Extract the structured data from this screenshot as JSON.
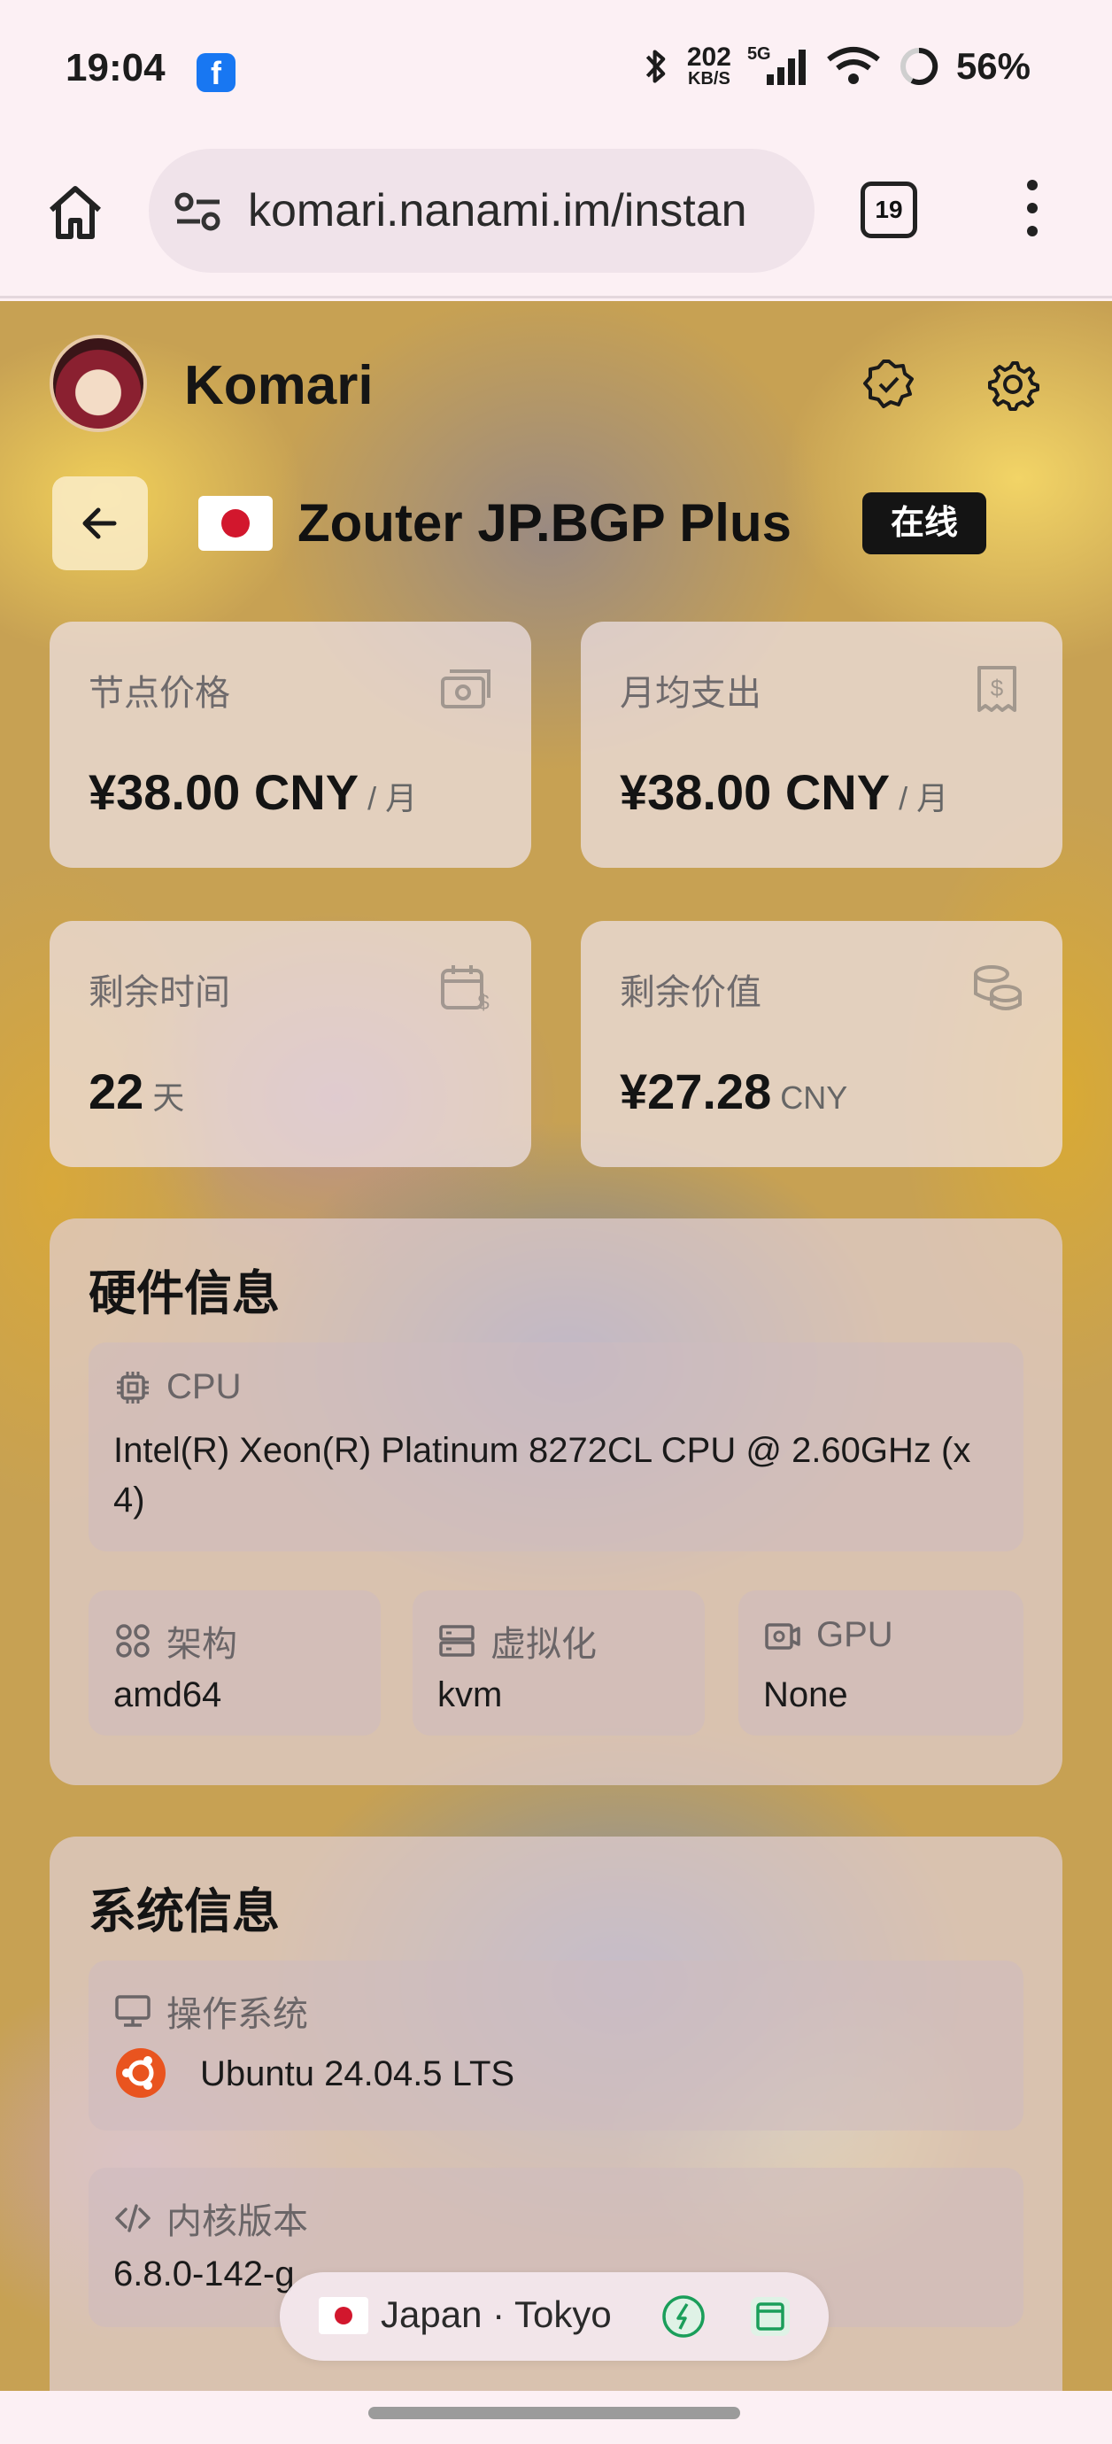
{
  "status_bar": {
    "time": "19:04",
    "net_speed_value": "202",
    "net_speed_unit": "KB/S",
    "signal_label": "5G",
    "battery": "56%",
    "notification_app": "f"
  },
  "browser": {
    "url": "komari.nanami.im/instan",
    "tab_count": "19"
  },
  "header": {
    "brand": "Komari"
  },
  "node": {
    "title": "Zouter JP.BGP Plus",
    "status": "在线"
  },
  "cards": {
    "price": {
      "label": "节点价格",
      "value": "¥38.00 CNY",
      "unit": "/ 月"
    },
    "monthly": {
      "label": "月均支出",
      "value": "¥38.00 CNY",
      "unit": "/ 月"
    },
    "remaining_time": {
      "label": "剩余时间",
      "value": "22",
      "unit": "天"
    },
    "remaining_value": {
      "label": "剩余价值",
      "value": "¥27.28",
      "unit": "CNY"
    }
  },
  "hardware": {
    "title": "硬件信息",
    "cpu_label": "CPU",
    "cpu_value": "Intel(R) Xeon(R) Platinum 8272CL CPU @ 2.60GHz (x 4)",
    "arch_label": "架构",
    "arch_value": "amd64",
    "virt_label": "虚拟化",
    "virt_value": "kvm",
    "gpu_label": "GPU",
    "gpu_value": "None"
  },
  "system": {
    "title": "系统信息",
    "os_label": "操作系统",
    "os_value": "Ubuntu 24.04.5 LTS",
    "kernel_label": "内核版本",
    "kernel_value": "6.8.0-142-g"
  },
  "bottom_pill": {
    "location": "Japan · Tokyo"
  },
  "colors": {
    "badge_bg": "#141414",
    "accent_green": "#1a9e5a",
    "ubuntu_orange": "#e9541f"
  }
}
